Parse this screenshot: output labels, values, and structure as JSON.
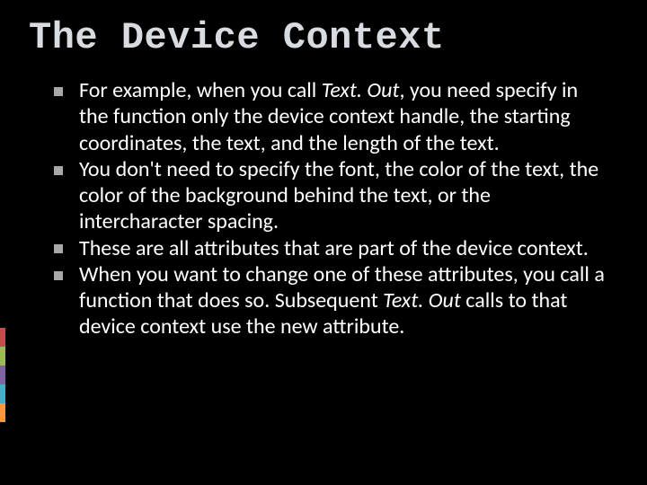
{
  "slide": {
    "title": "The Device Context",
    "bullets": [
      {
        "pre": "For example, when you call ",
        "em": "Text. Out",
        "post": ", you need specify in the function only the device context handle, the starting coordinates, the text, and the length of the text."
      },
      {
        "pre": "You don't need to specify the font, the color of the text, the color of the background behind the text, or the intercharacter spacing.",
        "em": "",
        "post": ""
      },
      {
        "pre": "These are all attributes that are part of the device context.",
        "em": "",
        "post": ""
      },
      {
        "pre": "When you want to change one of these attributes, you call a function that does so. Subsequent ",
        "em": "Text. Out",
        "post": " calls to that device context use the new attribute."
      }
    ]
  }
}
